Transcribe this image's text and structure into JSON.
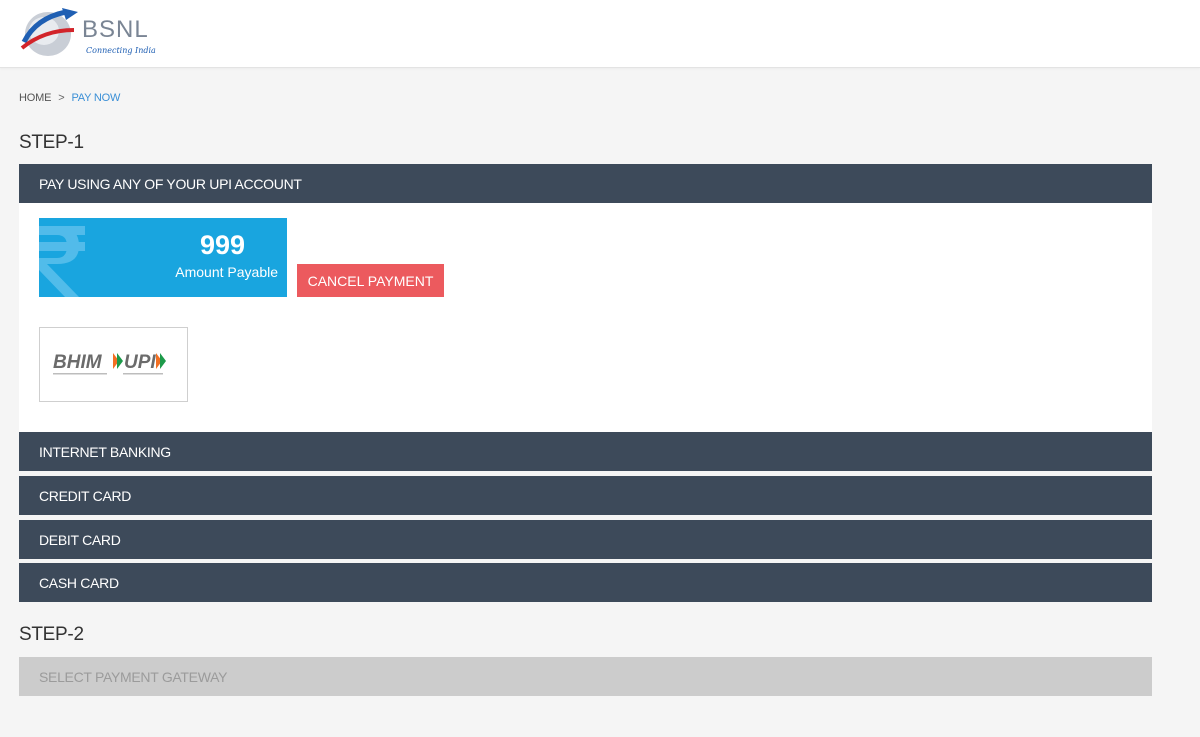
{
  "header": {
    "logo_text": "BSNL",
    "logo_tagline": "Connecting India"
  },
  "breadcrumb": {
    "home": "HOME",
    "separator": ">",
    "current": "PAY NOW"
  },
  "step1": {
    "title": "STEP-1",
    "upi": {
      "header": "PAY USING ANY OF YOUR UPI ACCOUNT",
      "amount": "999",
      "amount_label": "Amount Payable",
      "cancel_label": "CANCEL PAYMENT",
      "bhim_logo_text": "BHIM",
      "upi_logo_text": "UPI",
      "rupee_icon": "rupee-icon"
    },
    "methods": [
      {
        "label": "INTERNET BANKING"
      },
      {
        "label": "CREDIT CARD"
      },
      {
        "label": "DEBIT CARD"
      },
      {
        "label": "CASH CARD"
      }
    ]
  },
  "step2": {
    "title": "STEP-2",
    "gateway_label": "SELECT PAYMENT GATEWAY"
  },
  "colors": {
    "bar": "#3d4a5a",
    "amount_bg": "#19a5df",
    "cancel_bg": "#ec5a5e",
    "link": "#3a8fd6",
    "disabled_bar": "#cccccc"
  }
}
